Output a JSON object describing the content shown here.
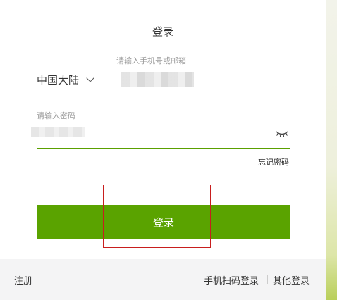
{
  "title": "登录",
  "account": {
    "region": "中国大陆",
    "placeholder": "请输入手机号或邮箱"
  },
  "password": {
    "placeholder": "请输入密码",
    "toggle_icon": "eye-closed-icon"
  },
  "forgot_password": "忘记密码",
  "login_button": "登录",
  "footer": {
    "register": "注册",
    "qr_login": "手机扫码登录",
    "other_login": "其他登录"
  },
  "colors": {
    "accent": "#5aa300",
    "highlight_box": "#c81e1e",
    "footer_bg": "#f4f4f5"
  }
}
